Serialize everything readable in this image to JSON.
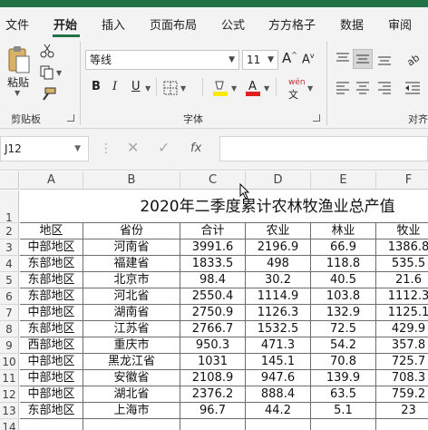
{
  "ribbon_tabs": [
    {
      "label": "文件"
    },
    {
      "label": "开始",
      "active": true
    },
    {
      "label": "插入"
    },
    {
      "label": "页面布局"
    },
    {
      "label": "公式"
    },
    {
      "label": "方方格子"
    },
    {
      "label": "数据"
    },
    {
      "label": "审阅"
    }
  ],
  "clipboard": {
    "paste_label": "粘贴",
    "group_label": "剪贴板"
  },
  "font": {
    "name": "等线",
    "size": "11",
    "group_label": "字体",
    "increase_glyph": "A",
    "decrease_glyph": "A",
    "bold": "B",
    "italic": "I",
    "underline": "U",
    "phonetic": "wén"
  },
  "alignment": {
    "group_label": "对齐"
  },
  "formula_bar": {
    "name_box": "J12",
    "cancel_glyph": "✕",
    "enter_glyph": "✓",
    "fx_glyph": "fx",
    "formula": ""
  },
  "colors": {
    "brand_green": "#217346",
    "font_color_red": "#e02020",
    "highlight_yellow": "#ffe800"
  },
  "sheet": {
    "columns": [
      "A",
      "B",
      "C",
      "D",
      "E",
      "F"
    ],
    "rows": [
      "1",
      "2",
      "3",
      "4",
      "5",
      "6",
      "7",
      "8",
      "9",
      "10",
      "11",
      "12",
      "13",
      "14"
    ],
    "title": "2020年二季度累计农林牧渔业总产值",
    "header": [
      "地区",
      "省份",
      "合计",
      "农业",
      "林业",
      "牧业"
    ],
    "data": [
      [
        "中部地区",
        "河南省",
        "3991.6",
        "2196.9",
        "66.9",
        "1386.8"
      ],
      [
        "东部地区",
        "福建省",
        "1833.5",
        "498",
        "118.8",
        "535.5"
      ],
      [
        "东部地区",
        "北京市",
        "98.4",
        "30.2",
        "40.5",
        "21.6"
      ],
      [
        "东部地区",
        "河北省",
        "2550.4",
        "1114.9",
        "103.8",
        "1112.3"
      ],
      [
        "中部地区",
        "湖南省",
        "2750.9",
        "1126.3",
        "132.9",
        "1125.1"
      ],
      [
        "东部地区",
        "江苏省",
        "2766.7",
        "1532.5",
        "72.5",
        "429.9"
      ],
      [
        "西部地区",
        "重庆市",
        "950.3",
        "471.3",
        "54.2",
        "357.8"
      ],
      [
        "中部地区",
        "黑龙江省",
        "1031",
        "145.1",
        "70.8",
        "725.7"
      ],
      [
        "中部地区",
        "安徽省",
        "2108.9",
        "947.6",
        "139.9",
        "708.3"
      ],
      [
        "中部地区",
        "湖北省",
        "2376.2",
        "888.4",
        "63.5",
        "759.2"
      ],
      [
        "东部地区",
        "上海市",
        "96.7",
        "44.2",
        "5.1",
        "23"
      ]
    ]
  }
}
